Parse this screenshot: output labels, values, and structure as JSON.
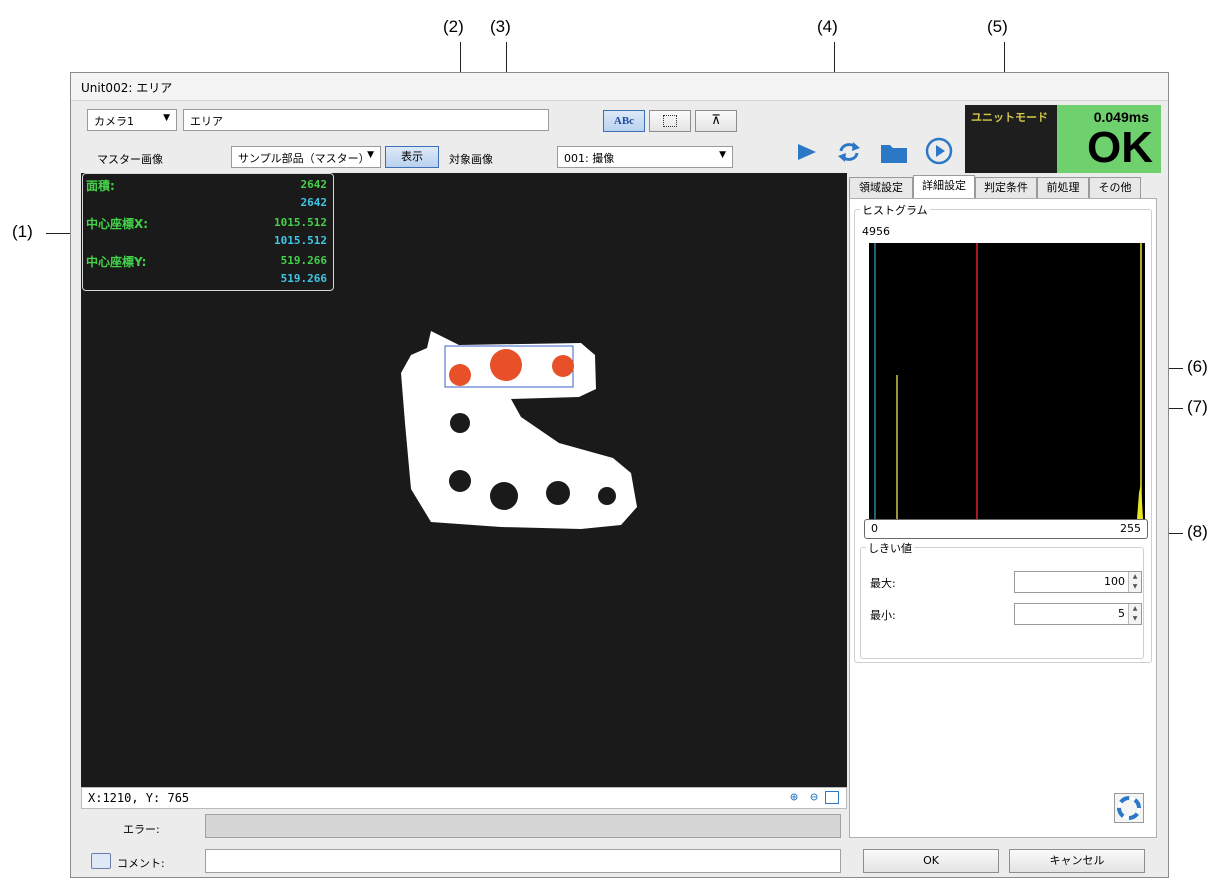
{
  "callouts": {
    "c1": "(1)",
    "c2": "(2)",
    "c3": "(3)",
    "c4": "(4)",
    "c5": "(5)",
    "c6": "(6)",
    "c7": "(7)",
    "c8": "(8)"
  },
  "window": {
    "title": "Unit002: エリア"
  },
  "toolbar": {
    "camera": "カメラ1",
    "name_value": "エリア",
    "icon_text_label": "ABc",
    "master_image_label": "マスター画像",
    "master_image_select": "サンプル部品（マスター）",
    "show_button": "表示",
    "target_image_label": "対象画像",
    "target_image_select": "001: 撮像"
  },
  "status": {
    "unit_mode": "ユニットモード",
    "time": "0.049ms",
    "result": "OK",
    "result_bg": "#6fd06e"
  },
  "overlay": {
    "area_label": "面積:",
    "area_value1": "2642",
    "area_value2": "2642",
    "cx_label": "中心座標X:",
    "cx_value1": "1015.512",
    "cx_value2": "1015.512",
    "cy_label": "中心座標Y:",
    "cy_value1": "519.266",
    "cy_value2": "519.266",
    "color_green": "#44d04a",
    "color_cyan": "#3fc6e6"
  },
  "viewer": {
    "coords": "X:1210, Y: 765"
  },
  "tabs": [
    "領域設定",
    "詳細設定",
    "判定条件",
    "前処理",
    "その他"
  ],
  "histogram": {
    "group_label": "ヒストグラム",
    "max_count": "4956",
    "axis_min": "0",
    "axis_max": "255",
    "threshold_max_level": 100,
    "threshold_min_level": 5,
    "pixel_peaks": [
      {
        "level": 16,
        "count_fraction": 0.56
      },
      {
        "level": 254,
        "count_fraction": 0.1
      }
    ]
  },
  "threshold": {
    "group_label": "しきい値",
    "max_label": "最大:",
    "max_value": "100",
    "min_label": "最小:",
    "min_value": "5"
  },
  "bottom": {
    "error_label": "エラー:",
    "comment_label": "コメント:",
    "ok_button": "OK",
    "cancel_button": "キャンセル"
  }
}
